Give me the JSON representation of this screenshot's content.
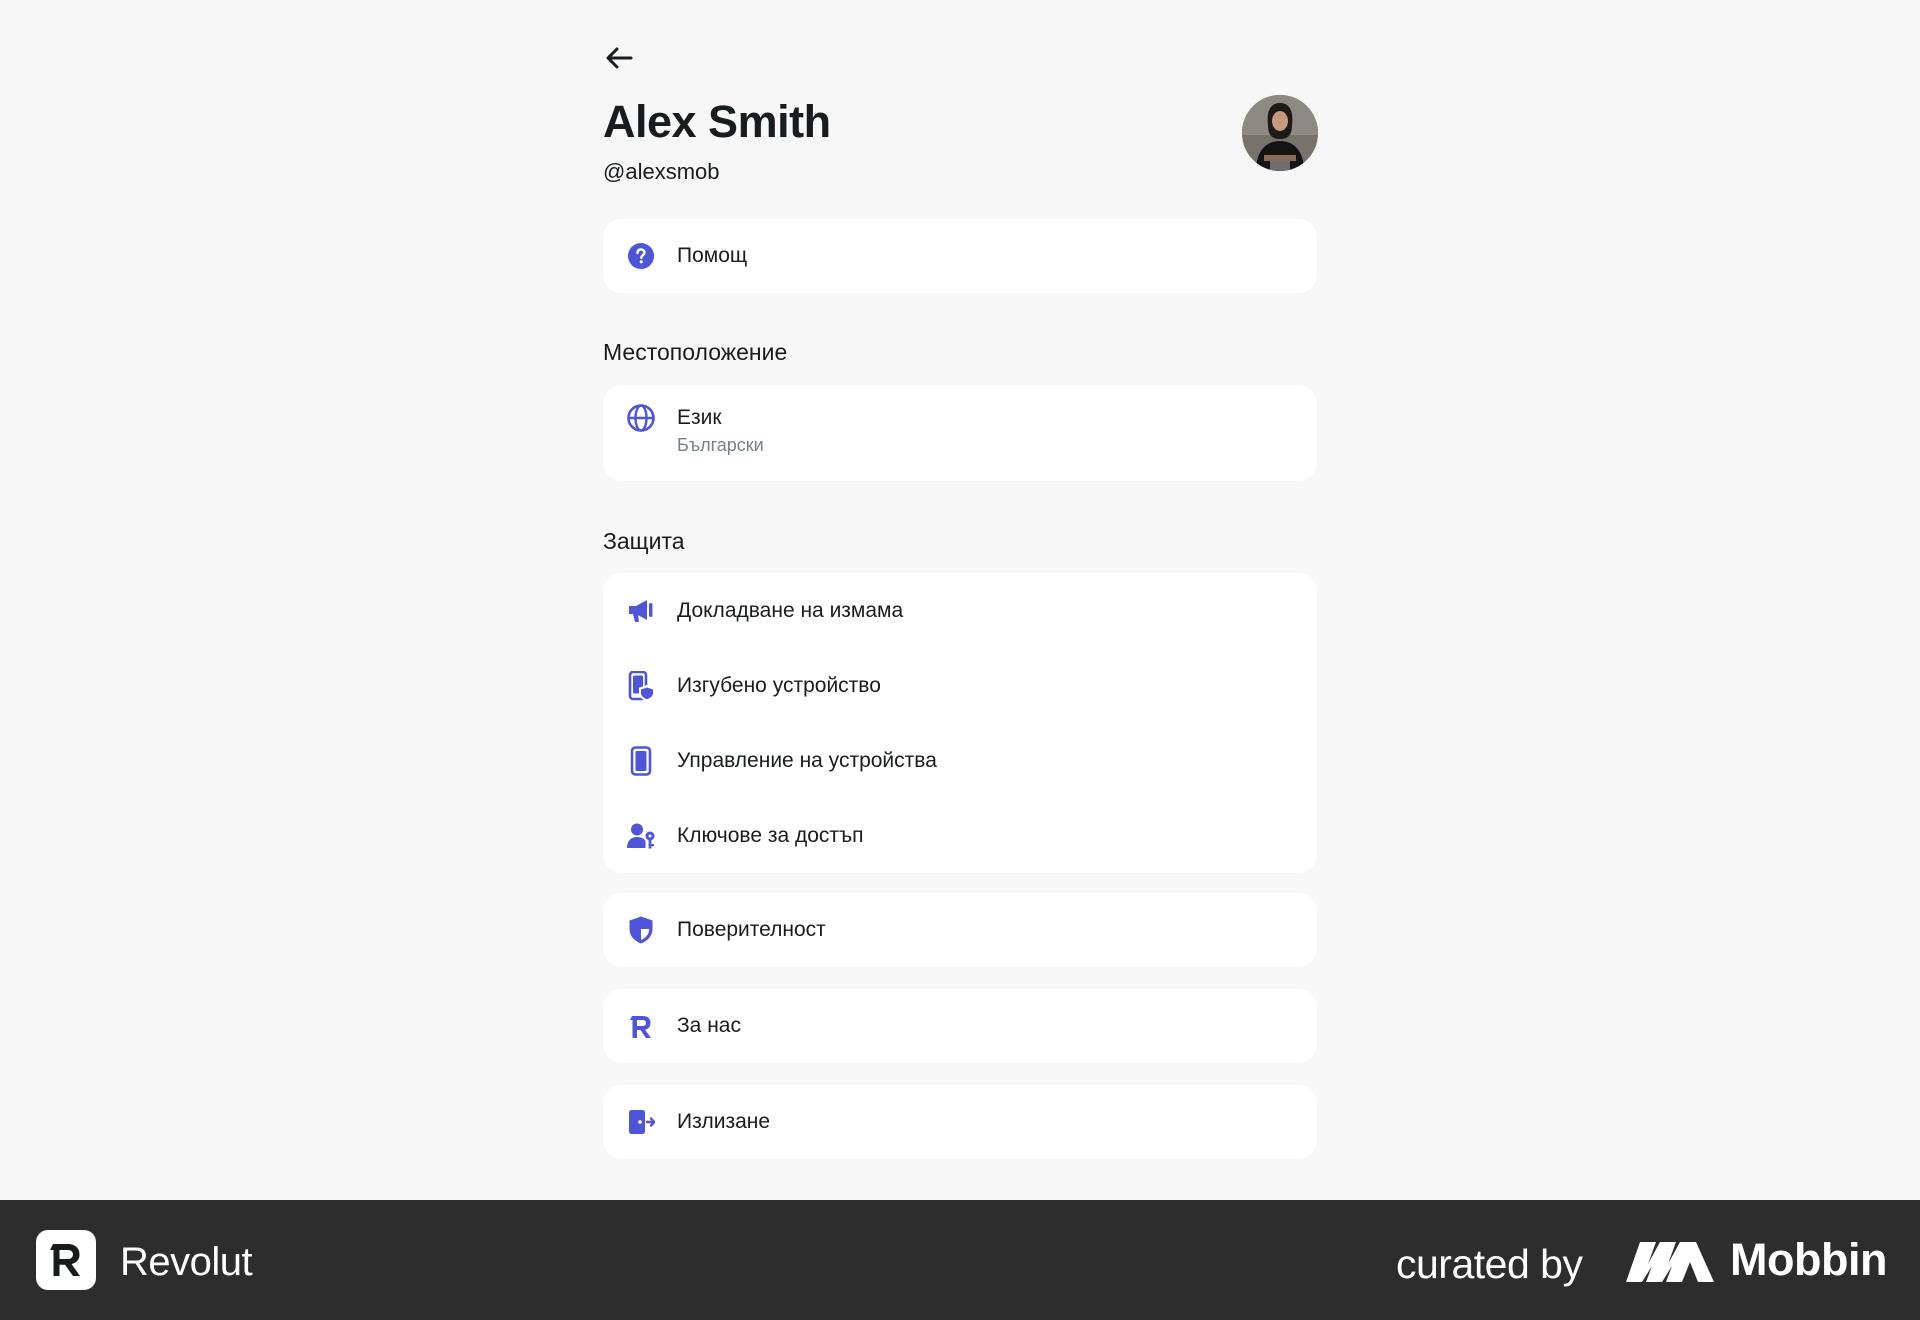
{
  "profile": {
    "name": "Alex Smith",
    "handle": "@alexsmob"
  },
  "help": {
    "label": "Помощ",
    "icon": "question-circle-icon"
  },
  "location": {
    "title": "Местоположение",
    "items": [
      {
        "label": "Език",
        "value": "Български",
        "icon": "globe-icon"
      }
    ]
  },
  "security": {
    "title": "Защита",
    "items": [
      {
        "label": "Докладване на измама",
        "icon": "megaphone-icon"
      },
      {
        "label": "Изгубено устройство",
        "icon": "phone-shield-icon"
      },
      {
        "label": "Управление на устройства",
        "icon": "phone-icon"
      },
      {
        "label": "Ключове за достъп",
        "icon": "user-key-icon"
      }
    ]
  },
  "privacy": {
    "label": "Поверителност",
    "icon": "shield-icon"
  },
  "about": {
    "label": "За нас",
    "icon": "revolut-r-icon"
  },
  "logout": {
    "label": "Излизане",
    "icon": "exit-door-icon"
  },
  "footer": {
    "app_name": "Revolut",
    "curated_by": "curated by",
    "brand": "Mobbin"
  },
  "colors": {
    "accent": "#4f55d9",
    "background": "#f7f7f7",
    "card": "#ffffff",
    "text": "#191c1f",
    "secondary_text": "#75808a",
    "footer_bg": "#2d2d2d"
  }
}
